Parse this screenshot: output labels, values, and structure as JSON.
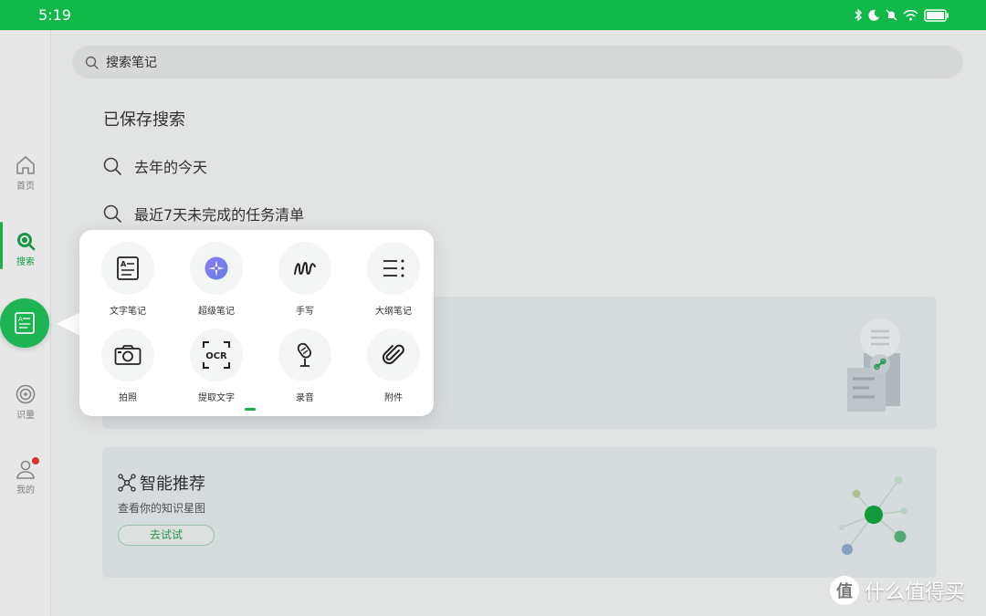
{
  "status_bar": {
    "time": "5:19"
  },
  "sidebar": {
    "items": [
      {
        "label": "首页"
      },
      {
        "label": "搜索"
      },
      {
        "label": "识量"
      },
      {
        "label": "我的"
      }
    ]
  },
  "search": {
    "placeholder": "搜索笔记"
  },
  "saved_searches": {
    "title": "已保存搜索",
    "items": [
      {
        "label": "去年的今天"
      },
      {
        "label": "最近7天未完成的任务清单"
      }
    ]
  },
  "recommend": {
    "title": "智能推荐",
    "subtitle": "查看你的知识星图",
    "button": "去试试"
  },
  "popup": {
    "items": [
      {
        "label": "文字笔记",
        "icon": "text-note-icon"
      },
      {
        "label": "超级笔记",
        "icon": "super-note-icon"
      },
      {
        "label": "手写",
        "icon": "handwriting-icon"
      },
      {
        "label": "大纲笔记",
        "icon": "outline-note-icon"
      },
      {
        "label": "拍照",
        "icon": "camera-icon"
      },
      {
        "label": "提取文字",
        "icon": "ocr-icon",
        "badge": "OCR"
      },
      {
        "label": "录音",
        "icon": "microphone-icon"
      },
      {
        "label": "附件",
        "icon": "paperclip-icon"
      }
    ]
  },
  "watermark": {
    "text": "什么值得买",
    "logo": "值"
  },
  "colors": {
    "accent": "#1fbf59",
    "status_bar": "#0fb847"
  }
}
